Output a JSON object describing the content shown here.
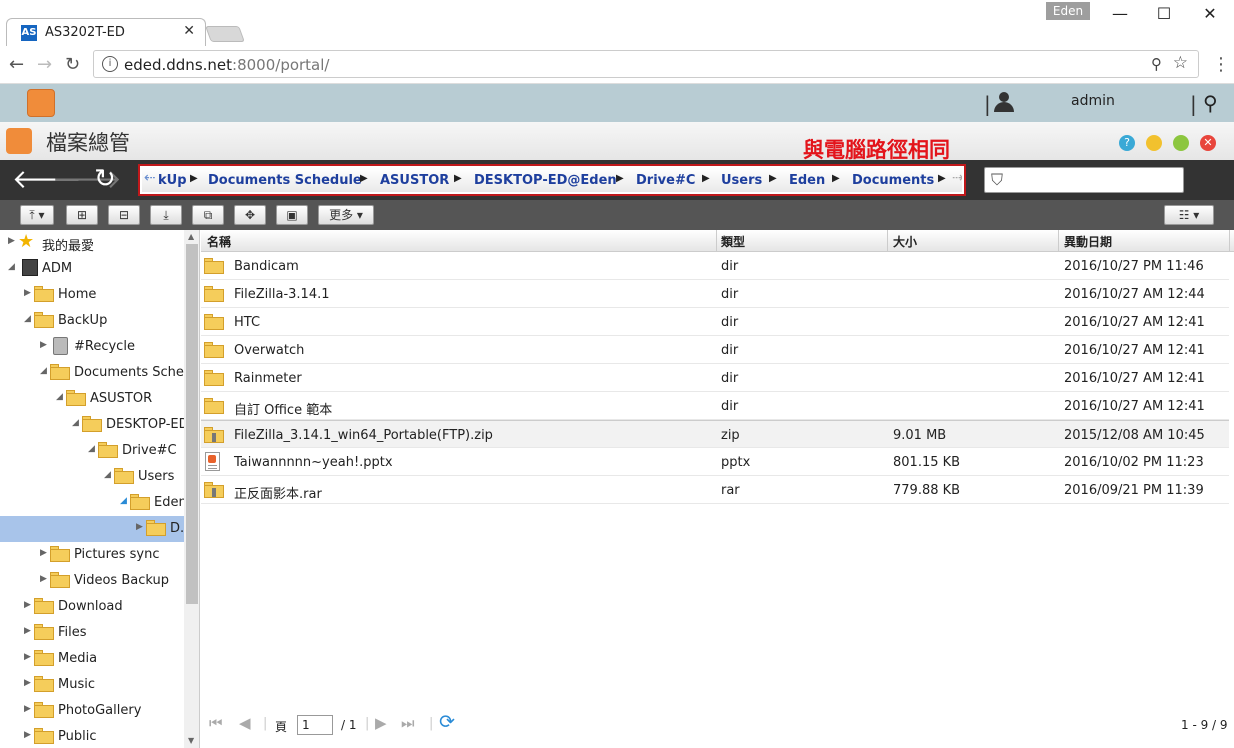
{
  "browser": {
    "tab_title": "AS3202T-ED",
    "tab_logo": "AS",
    "user_badge": "Eden",
    "url_host": "eded.ddns.net",
    "url_rest": ":8000/portal/"
  },
  "appbar": {
    "username": "admin"
  },
  "window": {
    "title": "檔案總管",
    "annotation": "與電腦路徑相同"
  },
  "breadcrumb": {
    "items": [
      "kUp",
      "Documents Schedule",
      "ASUSTOR",
      "DESKTOP-ED@Eden",
      "Drive#C",
      "Users",
      "Eden",
      "Documents"
    ]
  },
  "toolbar": {
    "more_label": "更多"
  },
  "sidebar": {
    "items": [
      {
        "label": "我的最愛"
      },
      {
        "label": "ADM"
      },
      {
        "label": "Home"
      },
      {
        "label": "BackUp"
      },
      {
        "label": "#Recycle"
      },
      {
        "label": "Documents Sched"
      },
      {
        "label": "ASUSTOR"
      },
      {
        "label": "DESKTOP-ED"
      },
      {
        "label": "Drive#C"
      },
      {
        "label": "Users"
      },
      {
        "label": "Eden"
      },
      {
        "label": "D."
      },
      {
        "label": "Pictures sync"
      },
      {
        "label": "Videos Backup"
      },
      {
        "label": "Download"
      },
      {
        "label": "Files"
      },
      {
        "label": "Media"
      },
      {
        "label": "Music"
      },
      {
        "label": "PhotoGallery"
      },
      {
        "label": "Public"
      }
    ]
  },
  "table": {
    "columns": [
      "名稱",
      "類型",
      "大小",
      "異動日期"
    ],
    "rows": [
      {
        "name": "Bandicam",
        "type": "dir",
        "size": "",
        "date": "2016/10/27 PM 11:46"
      },
      {
        "name": "FileZilla-3.14.1",
        "type": "dir",
        "size": "",
        "date": "2016/10/27 AM 12:44"
      },
      {
        "name": "HTC",
        "type": "dir",
        "size": "",
        "date": "2016/10/27 AM 12:41"
      },
      {
        "name": "Overwatch",
        "type": "dir",
        "size": "",
        "date": "2016/10/27 AM 12:41"
      },
      {
        "name": "Rainmeter",
        "type": "dir",
        "size": "",
        "date": "2016/10/27 AM 12:41"
      },
      {
        "name": "自訂 Office 範本",
        "type": "dir",
        "size": "",
        "date": "2016/10/27 AM 12:41"
      },
      {
        "name": "FileZilla_3.14.1_win64_Portable(FTP).zip",
        "type": "zip",
        "size": "9.01 MB",
        "date": "2015/12/08 AM 10:45"
      },
      {
        "name": "Taiwannnnn~yeah!.pptx",
        "type": "pptx",
        "size": "801.15 KB",
        "date": "2016/10/02 PM 11:23"
      },
      {
        "name": "正反面影本.rar",
        "type": "rar",
        "size": "779.88 KB",
        "date": "2016/09/21 PM 11:39"
      }
    ]
  },
  "pager": {
    "page_label": "頁",
    "page_value": "1",
    "total_label": "/ 1",
    "count_label": "1 - 9 / 9"
  },
  "colors": {
    "accent": "#f08c3a",
    "annotation": "#e3141b",
    "link": "#1e3f9e",
    "selection": "#a8c4ea"
  }
}
